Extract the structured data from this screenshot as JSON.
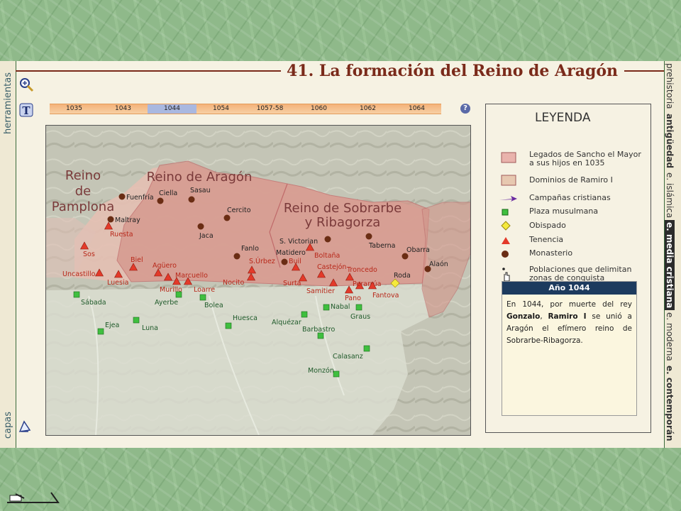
{
  "title": "41. La formación del Reino de Aragón",
  "sidebar_left": {
    "top_label": "herramientas",
    "bottom_label": "capas"
  },
  "sidebar_right": {
    "segments": [
      {
        "text": "prehistoria",
        "style": "normal"
      },
      {
        "text": "antigüedad",
        "style": "bold"
      },
      {
        "text": "e. islámica",
        "style": "normal"
      },
      {
        "text": "e. media cristiana",
        "style": "active"
      },
      {
        "text": "e. moderna",
        "style": "normal"
      },
      {
        "text": "e. contemporán",
        "style": "bold"
      }
    ]
  },
  "timeline": {
    "years": [
      "1035",
      "1043",
      "1044",
      "1054",
      "1057-58",
      "1060",
      "1062",
      "1064"
    ],
    "active": "1044",
    "help": "?"
  },
  "map": {
    "region_labels": {
      "pamplona": [
        "Reino",
        "de",
        "Pamplona"
      ],
      "aragon": "Reino de Aragón",
      "sobrarbe": [
        "Reino de Sobrarbe",
        "y Ribagorza"
      ]
    },
    "places": [
      {
        "name": "Fuenfría",
        "type": "monasterio"
      },
      {
        "name": "Ciella",
        "type": "monasterio"
      },
      {
        "name": "Sasau",
        "type": "monasterio"
      },
      {
        "name": "Maltray",
        "type": "monasterio"
      },
      {
        "name": "Cercito",
        "type": "monasterio"
      },
      {
        "name": "Jaca",
        "type": "monasterio"
      },
      {
        "name": "Ruesta",
        "type": "tenencia"
      },
      {
        "name": "S. Victorian",
        "type": "monasterio"
      },
      {
        "name": "Taberna",
        "type": "monasterio"
      },
      {
        "name": "Fanlo",
        "type": "monasterio"
      },
      {
        "name": "Sos",
        "type": "tenencia"
      },
      {
        "name": "Matidero",
        "type": "monasterio"
      },
      {
        "name": "Boltaña",
        "type": "tenencia"
      },
      {
        "name": "Obarra",
        "type": "monasterio"
      },
      {
        "name": "Biel",
        "type": "tenencia"
      },
      {
        "name": "Agüero",
        "type": "tenencia"
      },
      {
        "name": "S.Úrbez",
        "type": "tenencia"
      },
      {
        "name": "Buil",
        "type": "tenencia"
      },
      {
        "name": "Castejón",
        "type": "tenencia"
      },
      {
        "name": "Uncastillo",
        "type": "tenencia"
      },
      {
        "name": "Marcuello",
        "type": "tenencia"
      },
      {
        "name": "Troncedo",
        "type": "tenencia"
      },
      {
        "name": "Alaón",
        "type": "monasterio"
      },
      {
        "name": "Luesia",
        "type": "tenencia"
      },
      {
        "name": "Murillo",
        "type": "tenencia"
      },
      {
        "name": "Loarre",
        "type": "tenencia"
      },
      {
        "name": "Nocito",
        "type": "tenencia"
      },
      {
        "name": "Surta",
        "type": "tenencia"
      },
      {
        "name": "Roda",
        "type": "obispado"
      },
      {
        "name": "Perarrúa",
        "type": "tenencia"
      },
      {
        "name": "Samitier",
        "type": "tenencia"
      },
      {
        "name": "Fantova",
        "type": "tenencia"
      },
      {
        "name": "Pano",
        "type": "tenencia"
      },
      {
        "name": "Sábada",
        "type": "plaza"
      },
      {
        "name": "Ayerbe",
        "type": "plaza"
      },
      {
        "name": "Bolea",
        "type": "plaza"
      },
      {
        "name": "Nabal",
        "type": "plaza"
      },
      {
        "name": "Alquézar",
        "type": "plaza"
      },
      {
        "name": "Graus",
        "type": "plaza"
      },
      {
        "name": "Ejea",
        "type": "plaza"
      },
      {
        "name": "Luna",
        "type": "plaza"
      },
      {
        "name": "Huesca",
        "type": "plaza"
      },
      {
        "name": "Barbastro",
        "type": "plaza"
      },
      {
        "name": "Calasanz",
        "type": "plaza"
      },
      {
        "name": "Monzón",
        "type": "plaza"
      }
    ]
  },
  "legend": {
    "title": "LEYENDA",
    "items": [
      {
        "label": "Legados de Sancho el Mayor a sus hijos en 1035",
        "symbol": "legados"
      },
      {
        "label": "Dominios de Ramiro I",
        "symbol": "dominios"
      },
      {
        "label": "Campañas cristianas",
        "symbol": "arrow"
      },
      {
        "label": "Plaza musulmana",
        "symbol": "square"
      },
      {
        "label": "Obispado",
        "symbol": "diamond"
      },
      {
        "label": "Tenencia",
        "symbol": "triangle"
      },
      {
        "label": "Monasterio",
        "symbol": "circle"
      },
      {
        "label": "Poblaciones que delimitan zonas de conquista",
        "symbol": "dot-hand"
      }
    ],
    "colors": {
      "legados": "#e9b3ac",
      "dominios": "#e7c8b0",
      "arrow": "#6a2aa0",
      "square": "#3fbf3f",
      "diamond": "#f5ea3c",
      "triangle": "#e33a2a",
      "circle": "#6a2d14"
    }
  },
  "year_box": {
    "header": "Año 1044",
    "text_parts": [
      {
        "t": "En 1044, por muerte del rey ",
        "b": false
      },
      {
        "t": "Gonzalo",
        "b": true
      },
      {
        "t": ", ",
        "b": false
      },
      {
        "t": "Ramiro I",
        "b": true
      },
      {
        "t": " se unió a Aragón el efímero reino de Sobrarbe-Ribagorza.",
        "b": false
      }
    ]
  }
}
